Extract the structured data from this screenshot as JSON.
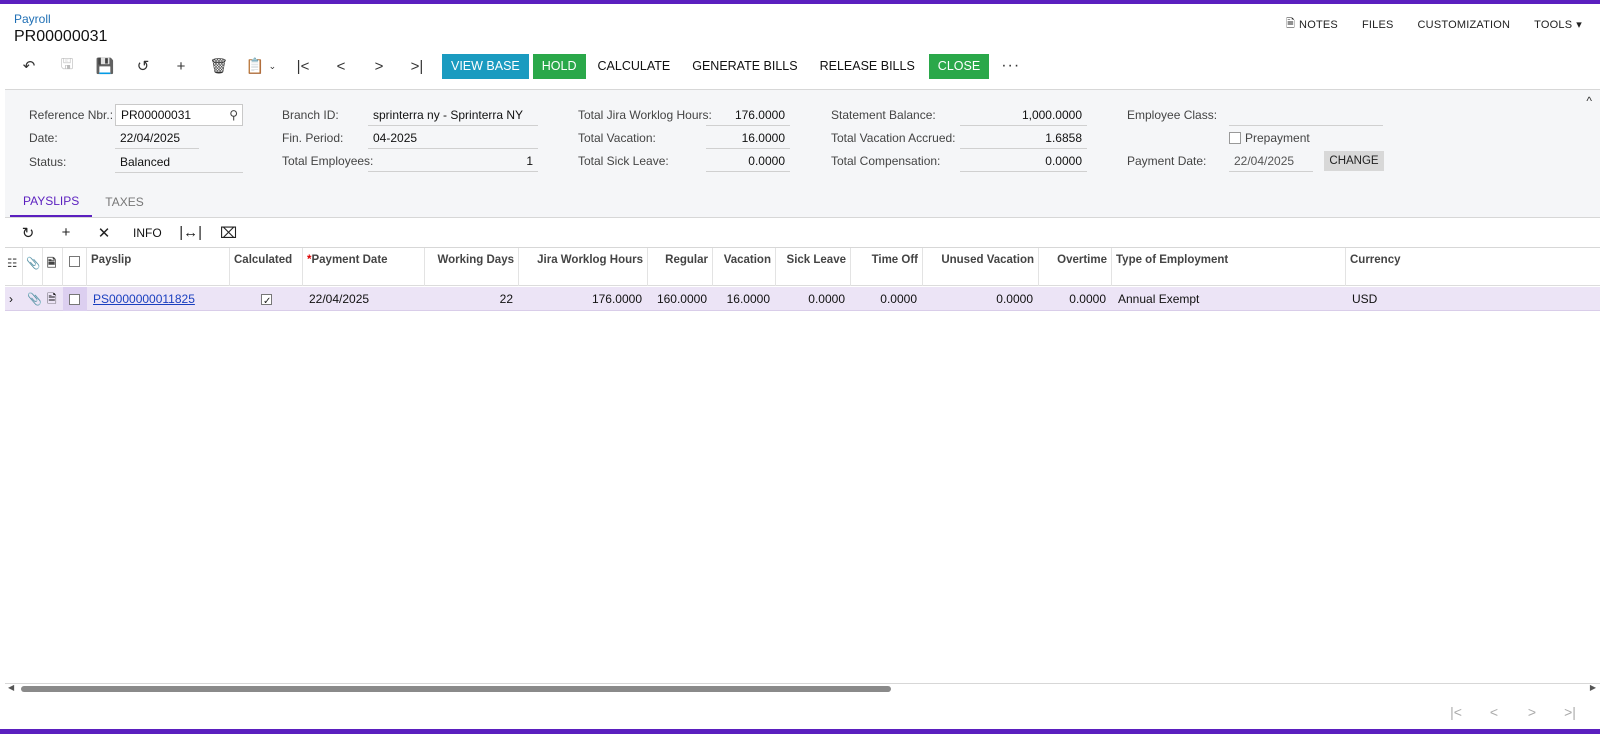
{
  "header": {
    "breadcrumb": "Payroll",
    "title": "PR00000031",
    "actions": [
      "NOTES",
      "FILES",
      "CUSTOMIZATION",
      "TOOLS"
    ]
  },
  "toolbar": {
    "view_base": "VIEW BASE",
    "hold": "HOLD",
    "calculate": "CALCULATE",
    "generate_bills": "GENERATE BILLS",
    "release_bills": "RELEASE BILLS",
    "close": "CLOSE",
    "more": "···"
  },
  "summary": {
    "reference_nbr_label": "Reference Nbr.:",
    "reference_nbr": "PR00000031",
    "date_label": "Date:",
    "date": "22/04/2025",
    "status_label": "Status:",
    "status": "Balanced",
    "branch_label": "Branch ID:",
    "branch": "sprinterra ny - Sprinterra NY",
    "fin_period_label": "Fin. Period:",
    "fin_period": "04-2025",
    "total_employees_label": "Total Employees:",
    "total_employees": "1",
    "jira_hours_label": "Total Jira Worklog Hours:",
    "jira_hours": "176.0000",
    "vacation_label": "Total Vacation:",
    "vacation": "16.0000",
    "sick_label": "Total Sick Leave:",
    "sick": "0.0000",
    "statement_balance_label": "Statement Balance:",
    "statement_balance": "1,000.0000",
    "vacation_accrued_label": "Total Vacation Accrued:",
    "vacation_accrued": "1.6858",
    "compensation_label": "Total Compensation:",
    "compensation": "0.0000",
    "employee_class_label": "Employee Class:",
    "employee_class": "",
    "prepayment_label": "Prepayment",
    "payment_date_label": "Payment Date:",
    "payment_date": "22/04/2025",
    "change": "CHANGE"
  },
  "tabs": [
    "PAYSLIPS",
    "TAXES"
  ],
  "grid_toolbar": {
    "info": "INFO"
  },
  "grid": {
    "columns": [
      "Payslip",
      "Calculated",
      "Payment Date",
      "Working Days",
      "Jira Worklog Hours",
      "Regular",
      "Vacation",
      "Sick Leave",
      "Time Off",
      "Unused Vacation",
      "Overtime",
      "Type of Employment",
      "Currency"
    ],
    "rows": [
      {
        "payslip": "PS0000000011825",
        "calculated": true,
        "payment_date": "22/04/2025",
        "working_days": "22",
        "jira_hours": "176.0000",
        "regular": "160.0000",
        "vacation": "16.0000",
        "sick_leave": "0.0000",
        "time_off": "0.0000",
        "unused_vacation": "0.0000",
        "overtime": "0.0000",
        "employment_type": "Annual Exempt",
        "currency": "USD"
      }
    ]
  },
  "colors": {
    "brand": "#5b1fbf",
    "teal": "#1a9bc0",
    "green": "#2aa84a",
    "selected_row": "#ece4f6"
  }
}
